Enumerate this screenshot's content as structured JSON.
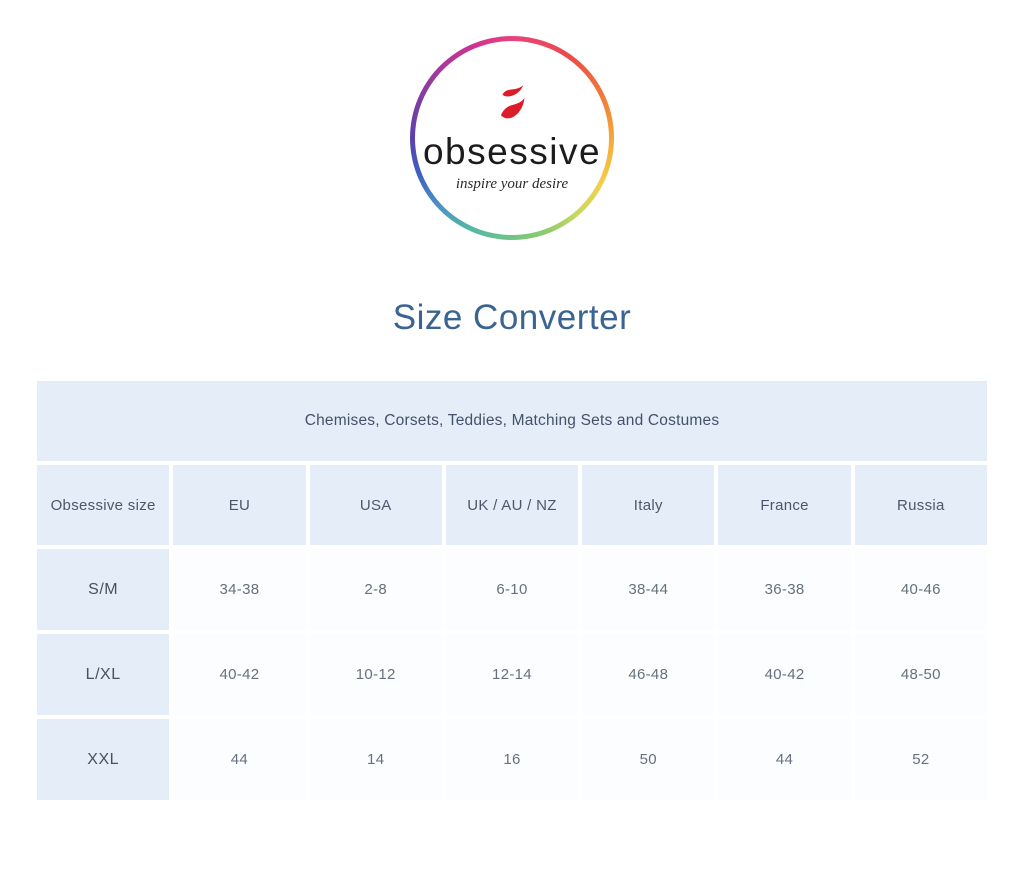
{
  "logo": {
    "brand": "obsessive",
    "tagline": "inspire your desire",
    "flame_color": "#dd1c2a",
    "ring_colors": [
      "#e8437c",
      "#f07a3a",
      "#f6ab38",
      "#f3cf4e",
      "#8fcb6e",
      "#55b8a6",
      "#3f5ec2",
      "#7d3da4",
      "#d13492"
    ]
  },
  "page": {
    "title": "Size Converter",
    "title_color": "#3a6492"
  },
  "table": {
    "banner": "Chemises, Corsets, Teddies, Matching Sets and Costumes",
    "columns": [
      "Obsessive size",
      "EU",
      "USA",
      "UK / AU / NZ",
      "Italy",
      "France",
      "Russia"
    ],
    "rows": [
      {
        "size": "S/M",
        "values": [
          "34-38",
          "2-8",
          "6-10",
          "38-44",
          "36-38",
          "40-46"
        ]
      },
      {
        "size": "L/XL",
        "values": [
          "40-42",
          "10-12",
          "12-14",
          "46-48",
          "40-42",
          "48-50"
        ]
      },
      {
        "size": "XXL",
        "values": [
          "44",
          "14",
          "16",
          "50",
          "44",
          "52"
        ]
      }
    ],
    "colors": {
      "cell_bg": "#e4edf8",
      "data_bg": "#fcfdfe",
      "gap": "#ffffff",
      "text": "#4c5869"
    }
  }
}
